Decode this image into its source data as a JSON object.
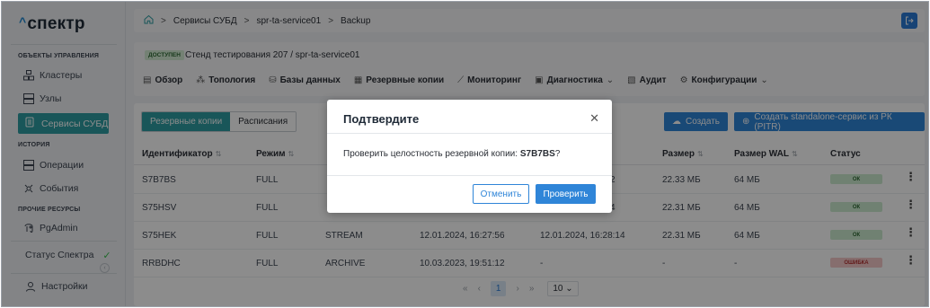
{
  "brand": {
    "caret": "^",
    "name": "спектр"
  },
  "sidebar": {
    "section_management": "ОБЪЕКТЫ УПРАВЛЕНИЯ",
    "clusters": "Кластеры",
    "nodes": "Узлы",
    "dbms_services": "Сервисы СУБД",
    "section_history": "ИСТОРИЯ",
    "operations": "Операции",
    "events": "События",
    "section_other": "ПРОЧИЕ РЕСУРСЫ",
    "pgadmin": "PgAdmin",
    "spectr_status": "Статус Спектра",
    "settings": "Настройки"
  },
  "breadcrumb": {
    "item1": "Сервисы СУБД",
    "item2": "spr-ta-service01",
    "item3": "Backup"
  },
  "header": {
    "status": "ДОСТУПЕН",
    "title": "Стенд тестирования 207 / spr-ta-service01"
  },
  "tabs": {
    "overview": "Обзор",
    "topology": "Топология",
    "databases": "Базы данных",
    "backups": "Резервные копии",
    "monitoring": "Мониторинг",
    "diagnostics": "Диагностика",
    "audit": "Аудит",
    "configurations": "Конфигурации"
  },
  "toolbar": {
    "seg_backups": "Резервные копии",
    "seg_schedules": "Расписания",
    "create": "Создать",
    "create_standalone": "Создать standalone-сервис из РК (PITR)"
  },
  "table": {
    "columns": {
      "id": "Идентификатор",
      "mode": "Режим",
      "size": "Размер",
      "wal_size": "Размер WAL",
      "status": "Статус"
    },
    "rows": [
      {
        "id": "S7B7BS",
        "mode": "FULL",
        "type": "",
        "started": "",
        "finished": "2",
        "size": "22.33 МБ",
        "wal": "64 МБ",
        "status": "ОК"
      },
      {
        "id": "S75HSV",
        "mode": "FULL",
        "type": "",
        "started": "",
        "finished": "4",
        "size": "22.31 МБ",
        "wal": "64 МБ",
        "status": "ОК"
      },
      {
        "id": "S75HEK",
        "mode": "FULL",
        "type": "STREAM",
        "started": "12.01.2024, 16:27:56",
        "finished": "12.01.2024, 16:28:14",
        "size": "22.31 МБ",
        "wal": "64 МБ",
        "status": "ОК"
      },
      {
        "id": "RRBDHC",
        "mode": "FULL",
        "type": "ARCHIVE",
        "started": "10.03.2023, 19:51:12",
        "finished": "-",
        "size": "-",
        "wal": "-",
        "status": "ОШИБКА"
      }
    ]
  },
  "pagination": {
    "first": "«",
    "prev": "‹",
    "current": "1",
    "next": "›",
    "last": "»",
    "page_size": "10"
  },
  "modal": {
    "title": "Подтвердите",
    "body_prefix": "Проверить целостность резервной копии:",
    "backup_id": "S7B7BS",
    "body_suffix": "?",
    "cancel": "Отменить",
    "confirm": "Проверить"
  },
  "colors": {
    "accent_teal": "#2e9da3",
    "primary_blue": "#2f85d8",
    "ok_bg": "#cdebd0",
    "error_bg": "#f5c9c9"
  }
}
